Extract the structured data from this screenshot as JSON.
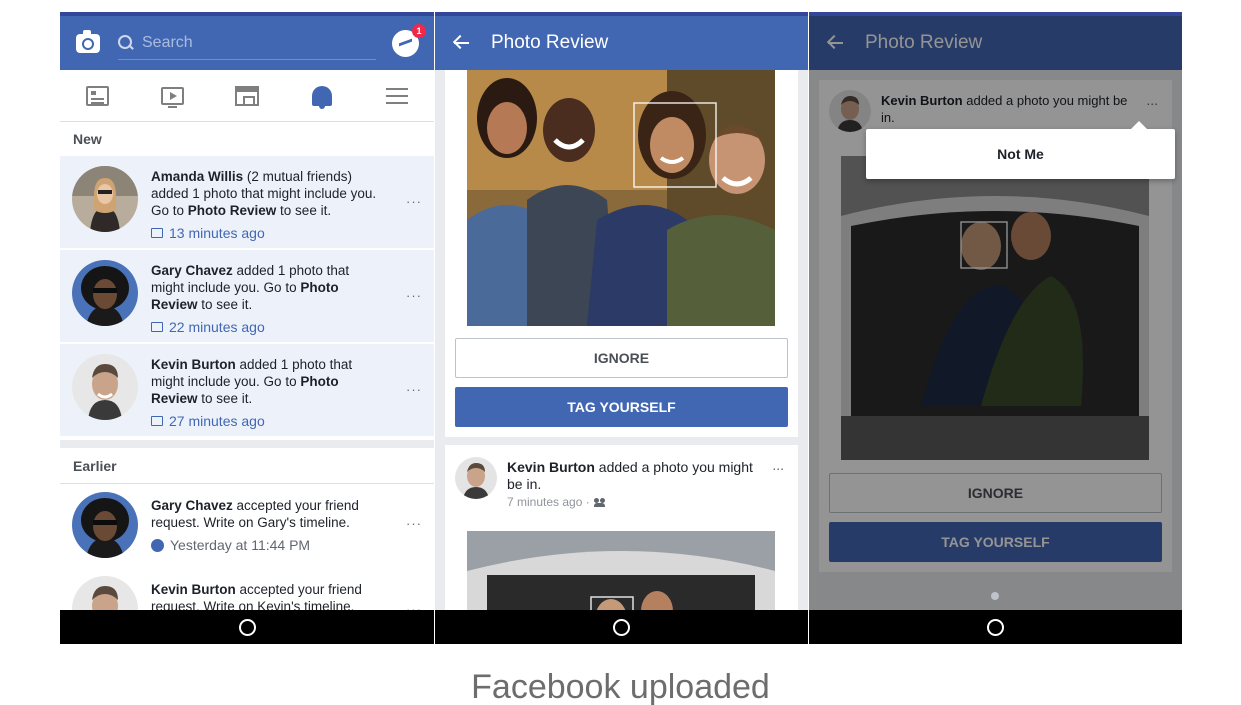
{
  "notifications_screen": {
    "search_placeholder": "Search",
    "messenger_badge": "1",
    "section_new": "New",
    "section_earlier": "Earlier",
    "items_new": [
      {
        "name": "Amanda Willis",
        "pre": " (2 mutual friends) added 1 photo that might include you. Go to ",
        "link": "Photo Review",
        "post": " to see it.",
        "time": "13 minutes ago"
      },
      {
        "name": "Gary Chavez",
        "pre": " added 1 photo that might include you. Go to ",
        "link": "Photo Review",
        "post": " to see it.",
        "time": "22 minutes ago"
      },
      {
        "name": "Kevin Burton",
        "pre": " added 1 photo that might include you. Go to ",
        "link": "Photo Review",
        "post": " to see it.",
        "time": "27 minutes ago"
      }
    ],
    "items_earlier": [
      {
        "name": "Gary Chavez",
        "text": " accepted your friend request. Write on Gary's timeline.",
        "time": "Yesterday at 11:44 PM"
      },
      {
        "name": "Kevin Burton",
        "text": " accepted your friend request. Write on Kevin's timeline."
      }
    ],
    "more": "···"
  },
  "photo_review_screen": {
    "title": "Photo Review",
    "ignore": "IGNORE",
    "tag_yourself": "TAG YOURSELF",
    "post_author": "Kevin Burton",
    "post_text": " added a photo you might be in.",
    "post_time": "7 minutes ago · ",
    "more": "..."
  },
  "not_me_screen": {
    "title": "Photo Review",
    "author": "Kevin Burton",
    "text": " added a photo you might be in.",
    "more": "...",
    "menu_not_me": "Not Me",
    "ignore": "IGNORE",
    "tag_yourself": "TAG YOURSELF"
  },
  "caption": "Facebook uploaded",
  "colors": {
    "brand": "#4267b2",
    "unread_bg": "#edf2fa",
    "link": "#4267b2"
  }
}
